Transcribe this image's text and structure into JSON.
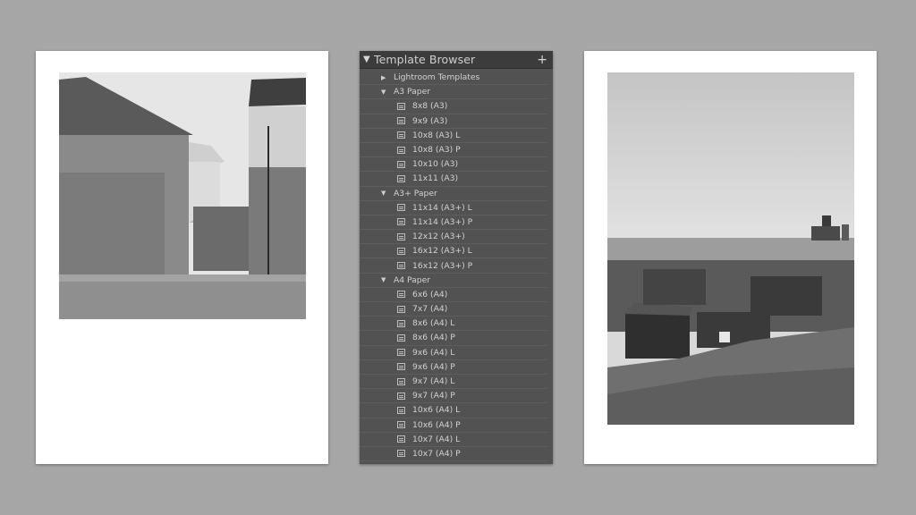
{
  "panel": {
    "title": "Template Browser",
    "add_icon": "+",
    "collapse_icon": "triangle-down-icon",
    "tree": [
      {
        "type": "folder",
        "label": "Lightroom Templates",
        "expanded": false
      },
      {
        "type": "folder",
        "label": "A3 Paper",
        "expanded": true
      },
      {
        "type": "item",
        "label": "8x8 (A3)"
      },
      {
        "type": "item",
        "label": "9x9 (A3)"
      },
      {
        "type": "item",
        "label": "10x8 (A3) L"
      },
      {
        "type": "item",
        "label": "10x8 (A3) P"
      },
      {
        "type": "item",
        "label": "10x10 (A3)"
      },
      {
        "type": "item",
        "label": "11x11 (A3)"
      },
      {
        "type": "folder",
        "label": "A3+ Paper",
        "expanded": true
      },
      {
        "type": "item",
        "label": "11x14 (A3+) L"
      },
      {
        "type": "item",
        "label": "11x14 (A3+) P"
      },
      {
        "type": "item",
        "label": "12x12 (A3+)"
      },
      {
        "type": "item",
        "label": "16x12 (A3+) L"
      },
      {
        "type": "item",
        "label": "16x12 (A3+) P"
      },
      {
        "type": "folder",
        "label": "A4 Paper",
        "expanded": true
      },
      {
        "type": "item",
        "label": "6x6 (A4)"
      },
      {
        "type": "item",
        "label": "7x7 (A4)"
      },
      {
        "type": "item",
        "label": "8x6 (A4) L"
      },
      {
        "type": "item",
        "label": "8x6 (A4) P"
      },
      {
        "type": "item",
        "label": "9x6 (A4) L"
      },
      {
        "type": "item",
        "label": "9x6 (A4) P"
      },
      {
        "type": "item",
        "label": "9x7 (A4) L"
      },
      {
        "type": "item",
        "label": "9x7 (A4) P"
      },
      {
        "type": "item",
        "label": "10x6 (A4) L"
      },
      {
        "type": "item",
        "label": "10x6 (A4) P"
      },
      {
        "type": "item",
        "label": "10x7 (A4) L"
      },
      {
        "type": "item",
        "label": "10x7 (A4) P"
      }
    ]
  },
  "colors": {
    "background": "#a6a6a6",
    "panel": "#525252",
    "panel_header": "#3c3c3c",
    "text": "#d2d2d2"
  },
  "pages": {
    "left_photo": "black-and-white-buildings-courtyard",
    "right_photo": "black-and-white-beach-huts-steelworks"
  }
}
